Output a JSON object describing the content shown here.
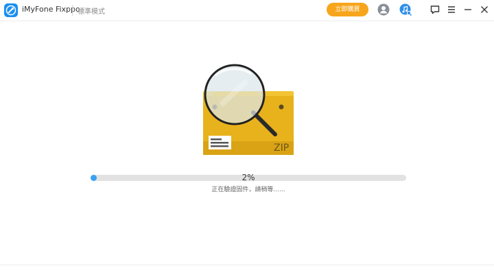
{
  "app": {
    "name": "iMyFone Fixppo",
    "mode": "標準模式",
    "logo_icon": "wrench-icon",
    "accent_color": "#1c8ff0"
  },
  "toolbar": {
    "buy_label": "立即購買",
    "buy_color": "#f7a51c",
    "icons": [
      "user-icon",
      "music-search-icon",
      "feedback-icon",
      "menu-icon",
      "minimize-icon",
      "close-icon"
    ]
  },
  "main": {
    "illustration": {
      "icon": "zip-box-magnifier-icon",
      "label": "ZIP"
    },
    "progress": {
      "value": 0.02,
      "text": "2%",
      "fill_color": "#3aa0f2"
    },
    "status": "正在驗證固件，請稍等......"
  }
}
